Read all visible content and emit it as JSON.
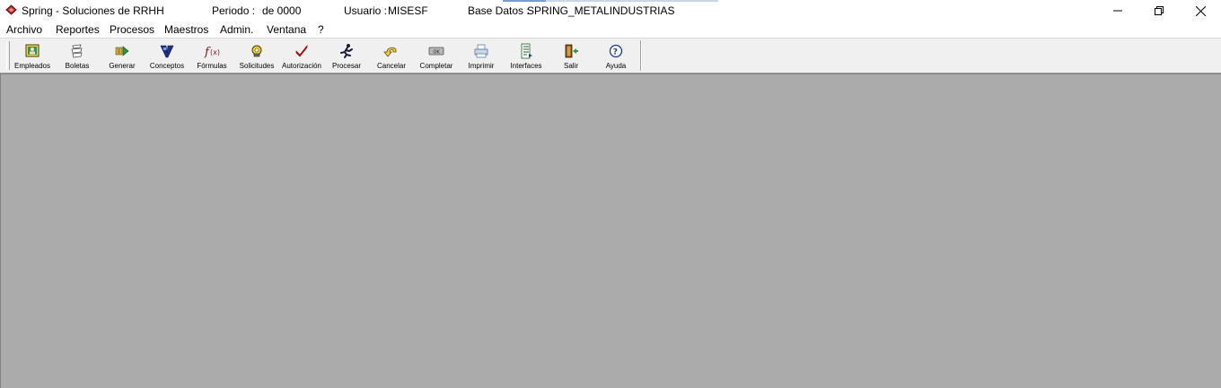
{
  "titlebar": {
    "app_name": "Spring - Soluciones de RRHH",
    "periodo_label": "Periodo :",
    "periodo_value": "de 0000",
    "usuario_label": "Usuario :",
    "usuario_value": "MISESF",
    "base_label": "Base Datos :",
    "base_value": "SPRING_METALINDUSTRIAS"
  },
  "menu": {
    "items": [
      "Archivo",
      "Reportes",
      "Procesos",
      "Maestros",
      "Admin.",
      "Ventana",
      "?"
    ]
  },
  "toolbar": {
    "buttons": [
      {
        "label": "Empleados",
        "icon": "employees-icon"
      },
      {
        "label": "Boletas",
        "icon": "payslip-icon"
      },
      {
        "label": "Generar",
        "icon": "generate-icon"
      },
      {
        "label": "Conceptos",
        "icon": "concepts-icon"
      },
      {
        "label": "Fórmulas",
        "icon": "formula-icon"
      },
      {
        "label": "Solicitudes",
        "icon": "requests-icon"
      },
      {
        "label": "Autorización",
        "icon": "checkmark-icon"
      },
      {
        "label": "Procesar",
        "icon": "running-man-icon"
      },
      {
        "label": "Cancelar",
        "icon": "undo-arrow-icon"
      },
      {
        "label": "Completar",
        "icon": "ok-key-icon"
      },
      {
        "label": "Imprimir",
        "icon": "printer-icon"
      },
      {
        "label": "Interfaces",
        "icon": "document-list-icon"
      },
      {
        "label": "Salir",
        "icon": "exit-door-icon"
      },
      {
        "label": "Ayuda",
        "icon": "help-icon"
      }
    ]
  },
  "colors": {
    "workspace": "#ababab",
    "toolbar": "#f0f0f0",
    "app_icon": "#c0282d"
  }
}
